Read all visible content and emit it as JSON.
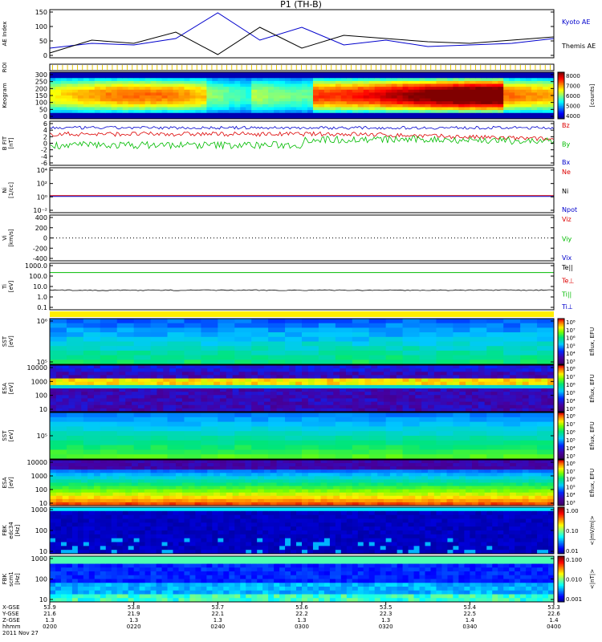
{
  "title": "P1 (TH-B)",
  "date_label": "2011 Nov 27",
  "colors": {
    "blue": "#0000cc",
    "red": "#dd0000",
    "green": "#00bb00",
    "black": "#000000",
    "yellow": "#ffee00",
    "gold": "#e6c800"
  },
  "chart_data": [
    {
      "type": "line",
      "id": "ae",
      "ylabel": "AE Index",
      "ylim": [
        0,
        150
      ],
      "yticks": [
        "150",
        "100",
        "50",
        "0"
      ],
      "x": [
        0,
        5,
        10,
        15,
        20,
        25,
        30,
        35,
        40,
        45,
        50,
        55,
        60
      ],
      "series": [
        {
          "name": "Kyoto AE",
          "color": "#0000cc",
          "values": [
            30,
            45,
            40,
            60,
            140,
            55,
            95,
            40,
            55,
            35,
            40,
            45,
            60
          ]
        },
        {
          "name": "Themis AE",
          "color": "#000000",
          "values": [
            15,
            55,
            45,
            80,
            10,
            95,
            30,
            70,
            60,
            50,
            45,
            55,
            65
          ]
        }
      ]
    },
    {
      "type": "table",
      "id": "roi",
      "ylabel": "ROI"
    },
    {
      "type": "heatmap",
      "id": "keogram",
      "ylabel": "Keogram",
      "yticks": [
        "300",
        "250",
        "200",
        "150",
        "100",
        "50",
        "0"
      ],
      "colorbar": {
        "ticks": [
          "8000",
          "7000",
          "6000",
          "5000",
          "4000"
        ],
        "label": "[counts]"
      }
    },
    {
      "type": "line",
      "id": "bfield",
      "ylabel": [
        "B FIT",
        "[nT]"
      ],
      "ylim": [
        -6,
        6
      ],
      "yticks": [
        "6",
        "4",
        "2",
        "0",
        "-2",
        "-4",
        "-6"
      ],
      "series": [
        {
          "name": "Bz",
          "color": "#dd0000"
        },
        {
          "name": "By",
          "color": "#00bb00"
        },
        {
          "name": "Bx",
          "color": "#0000cc"
        }
      ]
    },
    {
      "type": "line",
      "id": "density",
      "ylabel": [
        "Ni",
        "[1/cc]"
      ],
      "yticks": [
        "10⁴",
        "10²",
        "10⁰",
        "10⁻²"
      ],
      "series": [
        {
          "name": "Ne",
          "color": "#dd0000"
        },
        {
          "name": "Ni",
          "color": "#000000"
        },
        {
          "name": "Npot",
          "color": "#0000cc"
        }
      ]
    },
    {
      "type": "line",
      "id": "velocity",
      "ylabel": [
        "Vi",
        "[km/s]"
      ],
      "ylim": [
        -400,
        400
      ],
      "yticks": [
        "400",
        "200",
        "0",
        "-200",
        "-400"
      ],
      "series": [
        {
          "name": "Viz",
          "color": "#dd0000"
        },
        {
          "name": "Viy",
          "color": "#00bb00"
        },
        {
          "name": "Vix",
          "color": "#0000cc"
        }
      ]
    },
    {
      "type": "line",
      "id": "temperature",
      "ylabel": [
        "Ti",
        "[eV]"
      ],
      "yticks": [
        "1000.0",
        "100.0",
        "10.0",
        "1.0",
        "0.1"
      ],
      "series": [
        {
          "name": "Te||",
          "color": "#000000"
        },
        {
          "name": "Te⊥",
          "color": "#dd0000"
        },
        {
          "name": "Ti||",
          "color": "#00bb00"
        },
        {
          "name": "Ti⊥",
          "color": "#0000cc"
        }
      ]
    },
    {
      "type": "heatmap",
      "id": "sst_ion",
      "ylabel": [
        "SST",
        "[eV]"
      ],
      "yticks": [
        "10⁶",
        "10⁵"
      ],
      "colorbar": {
        "ticks": [
          "10⁸",
          "10⁷",
          "10⁶",
          "10⁵",
          "10⁴",
          "10³"
        ],
        "label": "Eflux, EFU"
      }
    },
    {
      "type": "heatmap",
      "id": "esa_ion",
      "ylabel": [
        "ESA",
        "[eV]"
      ],
      "yticks": [
        "10000",
        "1000",
        "100",
        "10"
      ],
      "colorbar": {
        "ticks": [
          "10⁸",
          "10⁷",
          "10⁶",
          "10⁵",
          "10⁴",
          "10³"
        ],
        "label": "Eflux, EFU"
      }
    },
    {
      "type": "heatmap",
      "id": "sst_elec",
      "ylabel": [
        "SST",
        "[eV]"
      ],
      "yticks": [
        "10⁵"
      ],
      "colorbar": {
        "ticks": [
          "10⁸",
          "10⁷",
          "10⁶",
          "10⁵",
          "10⁴",
          "10³"
        ],
        "label": "Eflux, EFU"
      }
    },
    {
      "type": "heatmap",
      "id": "esa_elec",
      "ylabel": [
        "ESA",
        "[eV]"
      ],
      "yticks": [
        "10000",
        "1000",
        "100",
        "10"
      ],
      "colorbar": {
        "ticks": [
          "10⁸",
          "10⁷",
          "10⁶",
          "10⁵",
          "10⁴",
          "10³"
        ],
        "label": "Eflux, EFU"
      }
    },
    {
      "type": "heatmap",
      "id": "fbk_edc",
      "ylabel": [
        "FBK",
        "edc34",
        "[Hz]"
      ],
      "yticks": [
        "1000",
        "100",
        "10"
      ],
      "colorbar": {
        "ticks": [
          "1.00",
          "0.10",
          "0.01"
        ],
        "label": "<|mV/m|>"
      }
    },
    {
      "type": "heatmap",
      "id": "fbk_scm",
      "ylabel": [
        "FBK",
        "scm1",
        "[Hz]"
      ],
      "yticks": [
        "1000",
        "100",
        "10"
      ],
      "colorbar": {
        "ticks": [
          "0.100",
          "0.010",
          "0.001"
        ],
        "label": "<|nT|>"
      }
    }
  ],
  "x_axis": {
    "row_labels": [
      "X-GSE",
      "Y-GSE",
      "Z-GSE",
      "hhmm",
      "2011 Nov 27"
    ],
    "ticks": [
      {
        "x": "53.9",
        "y": "21.6",
        "z": "1.3",
        "t": "0200"
      },
      {
        "x": "53.8",
        "y": "21.9",
        "z": "1.3",
        "t": "0220"
      },
      {
        "x": "53.7",
        "y": "22.1",
        "z": "1.3",
        "t": "0240"
      },
      {
        "x": "53.6",
        "y": "22.2",
        "z": "1.3",
        "t": "0300"
      },
      {
        "x": "53.5",
        "y": "22.3",
        "z": "1.3",
        "t": "0320"
      },
      {
        "x": "53.4",
        "y": "22.5",
        "z": "1.4",
        "t": "0340"
      },
      {
        "x": "53.3",
        "y": "22.6",
        "z": "1.4",
        "t": "0400"
      }
    ]
  }
}
